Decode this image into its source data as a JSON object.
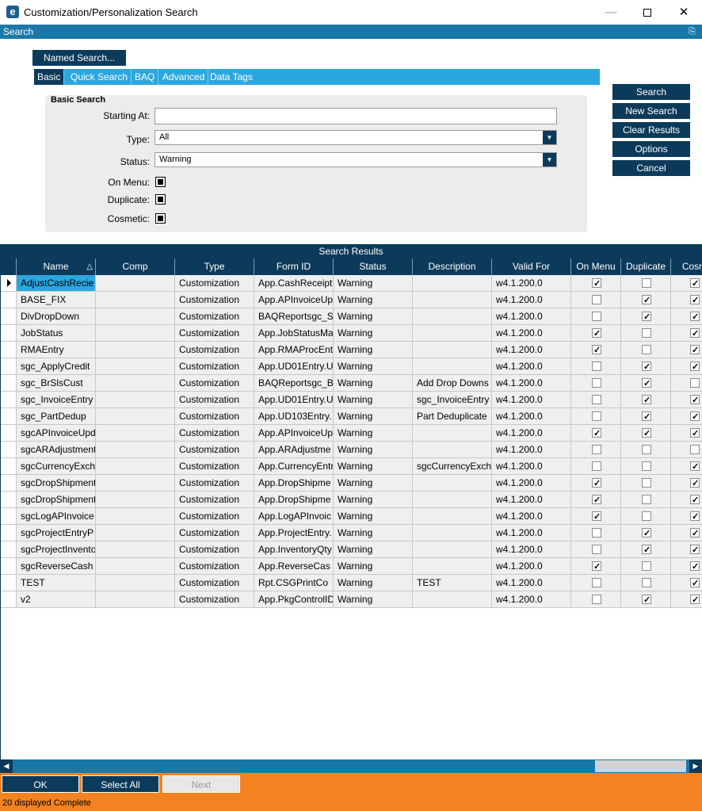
{
  "window": {
    "title": "Customization/Personalization Search",
    "icon_letter": "e",
    "minimize": "—",
    "close": "✕"
  },
  "search_panel": {
    "header": "Search",
    "named_search": "Named Search...",
    "tabs": [
      {
        "label": "Basic",
        "active": true
      },
      {
        "label": "Quick Search",
        "active": false
      },
      {
        "label": "BAQ",
        "active": false
      },
      {
        "label": "Advanced",
        "active": false
      },
      {
        "label": "Data Tags",
        "active": false
      }
    ],
    "basic": {
      "title": "Basic Search",
      "starting_at_label": "Starting At:",
      "starting_at_value": "",
      "type_label": "Type:",
      "type_value": "All",
      "status_label": "Status:",
      "status_value": "Warning",
      "on_menu_label": "On Menu:",
      "duplicate_label": "Duplicate:",
      "cosmetic_label": "Cosmetic:"
    },
    "buttons": {
      "search": "Search",
      "new_search": "New Search",
      "clear_results": "Clear Results",
      "options": "Options",
      "cancel": "Cancel"
    }
  },
  "results": {
    "header": "Search Results",
    "columns": [
      "Name",
      "Comp",
      "Type",
      "Form ID",
      "Status",
      "Description",
      "Valid For",
      "On Menu",
      "Duplicate",
      "Cosm"
    ],
    "rows": [
      {
        "name": "AdjustCashRecie",
        "comp": "",
        "type": "Customization",
        "form_id": "App.CashReceipt",
        "status": "Warning",
        "description": "",
        "valid_for": "w4.1.200.0",
        "on_menu": true,
        "duplicate": false,
        "cosmetic": true
      },
      {
        "name": "BASE_FIX",
        "comp": "",
        "type": "Customization",
        "form_id": "App.APInvoiceUp",
        "status": "Warning",
        "description": "",
        "valid_for": "w4.1.200.0",
        "on_menu": false,
        "duplicate": true,
        "cosmetic": true
      },
      {
        "name": "DivDropDown",
        "comp": "",
        "type": "Customization",
        "form_id": "BAQReportsgc_S",
        "status": "Warning",
        "description": "",
        "valid_for": "w4.1.200.0",
        "on_menu": false,
        "duplicate": true,
        "cosmetic": true
      },
      {
        "name": "JobStatus",
        "comp": "",
        "type": "Customization",
        "form_id": "App.JobStatusMa",
        "status": "Warning",
        "description": "",
        "valid_for": "w4.1.200.0",
        "on_menu": true,
        "duplicate": false,
        "cosmetic": true
      },
      {
        "name": "RMAEntry",
        "comp": "",
        "type": "Customization",
        "form_id": "App.RMAProcEnt",
        "status": "Warning",
        "description": "",
        "valid_for": "w4.1.200.0",
        "on_menu": true,
        "duplicate": false,
        "cosmetic": true
      },
      {
        "name": "sgc_ApplyCredit",
        "comp": "",
        "type": "Customization",
        "form_id": "App.UD01Entry.U",
        "status": "Warning",
        "description": "",
        "valid_for": "w4.1.200.0",
        "on_menu": false,
        "duplicate": true,
        "cosmetic": true
      },
      {
        "name": "sgc_BrSlsCust",
        "comp": "",
        "type": "Customization",
        "form_id": "BAQReportsgc_B",
        "status": "Warning",
        "description": "Add Drop Downs",
        "valid_for": "w4.1.200.0",
        "on_menu": false,
        "duplicate": true,
        "cosmetic": false
      },
      {
        "name": "sgc_InvoiceEntry",
        "comp": "",
        "type": "Customization",
        "form_id": "App.UD01Entry.U",
        "status": "Warning",
        "description": "sgc_InvoiceEntry",
        "valid_for": "w4.1.200.0",
        "on_menu": false,
        "duplicate": true,
        "cosmetic": true
      },
      {
        "name": "sgc_PartDedup",
        "comp": "",
        "type": "Customization",
        "form_id": "App.UD103Entry.",
        "status": "Warning",
        "description": "Part Deduplicate",
        "valid_for": "w4.1.200.0",
        "on_menu": false,
        "duplicate": true,
        "cosmetic": true
      },
      {
        "name": "sgcAPInvoiceUpd",
        "comp": "",
        "type": "Customization",
        "form_id": "App.APInvoiceUp",
        "status": "Warning",
        "description": "",
        "valid_for": "w4.1.200.0",
        "on_menu": true,
        "duplicate": true,
        "cosmetic": true
      },
      {
        "name": "sgcARAdjustment",
        "comp": "",
        "type": "Customization",
        "form_id": "App.ARAdjustme",
        "status": "Warning",
        "description": "",
        "valid_for": "w4.1.200.0",
        "on_menu": false,
        "duplicate": false,
        "cosmetic": false
      },
      {
        "name": "sgcCurrencyExch",
        "comp": "",
        "type": "Customization",
        "form_id": "App.CurrencyEntr",
        "status": "Warning",
        "description": "sgcCurrencyExch",
        "valid_for": "w4.1.200.0",
        "on_menu": false,
        "duplicate": false,
        "cosmetic": true
      },
      {
        "name": "sgcDropShipment",
        "comp": "",
        "type": "Customization",
        "form_id": "App.DropShipme",
        "status": "Warning",
        "description": "",
        "valid_for": "w4.1.200.0",
        "on_menu": true,
        "duplicate": false,
        "cosmetic": true
      },
      {
        "name": "sgcDropShipment",
        "comp": "",
        "type": "Customization",
        "form_id": "App.DropShipme",
        "status": "Warning",
        "description": "",
        "valid_for": "w4.1.200.0",
        "on_menu": true,
        "duplicate": false,
        "cosmetic": true
      },
      {
        "name": "sgcLogAPInvoice",
        "comp": "",
        "type": "Customization",
        "form_id": "App.LogAPInvoic",
        "status": "Warning",
        "description": "",
        "valid_for": "w4.1.200.0",
        "on_menu": true,
        "duplicate": false,
        "cosmetic": true
      },
      {
        "name": "sgcProjectEntryP",
        "comp": "",
        "type": "Customization",
        "form_id": "App.ProjectEntry.",
        "status": "Warning",
        "description": "",
        "valid_for": "w4.1.200.0",
        "on_menu": false,
        "duplicate": true,
        "cosmetic": true
      },
      {
        "name": "sgcProjectInvento",
        "comp": "",
        "type": "Customization",
        "form_id": "App.InventoryQty",
        "status": "Warning",
        "description": "",
        "valid_for": "w4.1.200.0",
        "on_menu": false,
        "duplicate": true,
        "cosmetic": true
      },
      {
        "name": "sgcReverseCash",
        "comp": "",
        "type": "Customization",
        "form_id": "App.ReverseCas",
        "status": "Warning",
        "description": "",
        "valid_for": "w4.1.200.0",
        "on_menu": true,
        "duplicate": false,
        "cosmetic": true
      },
      {
        "name": "TEST",
        "comp": "",
        "type": "Customization",
        "form_id": "Rpt.CSGPrintCo",
        "status": "Warning",
        "description": "TEST",
        "valid_for": "w4.1.200.0",
        "on_menu": false,
        "duplicate": false,
        "cosmetic": true
      },
      {
        "name": "v2",
        "comp": "",
        "type": "Customization",
        "form_id": "App.PkgControlID",
        "status": "Warning",
        "description": "",
        "valid_for": "w4.1.200.0",
        "on_menu": false,
        "duplicate": true,
        "cosmetic": true
      }
    ]
  },
  "footer": {
    "ok": "OK",
    "select_all": "Select All",
    "next": "Next",
    "status": "20 displayed Complete"
  },
  "colors": {
    "primary_dark": "#0c3a5a",
    "accent_blue": "#2aa7e0",
    "header_blue": "#1a78a8",
    "footer_orange": "#f58220"
  },
  "icons": {
    "app": "epicor-e-icon",
    "pin": "pin-icon",
    "dropdown": "chevron-down-icon",
    "sort": "sort-ascending-icon",
    "row_selector": "row-selector-arrow-icon",
    "scroll_left": "scroll-left-icon",
    "scroll_right": "scroll-right-icon"
  }
}
